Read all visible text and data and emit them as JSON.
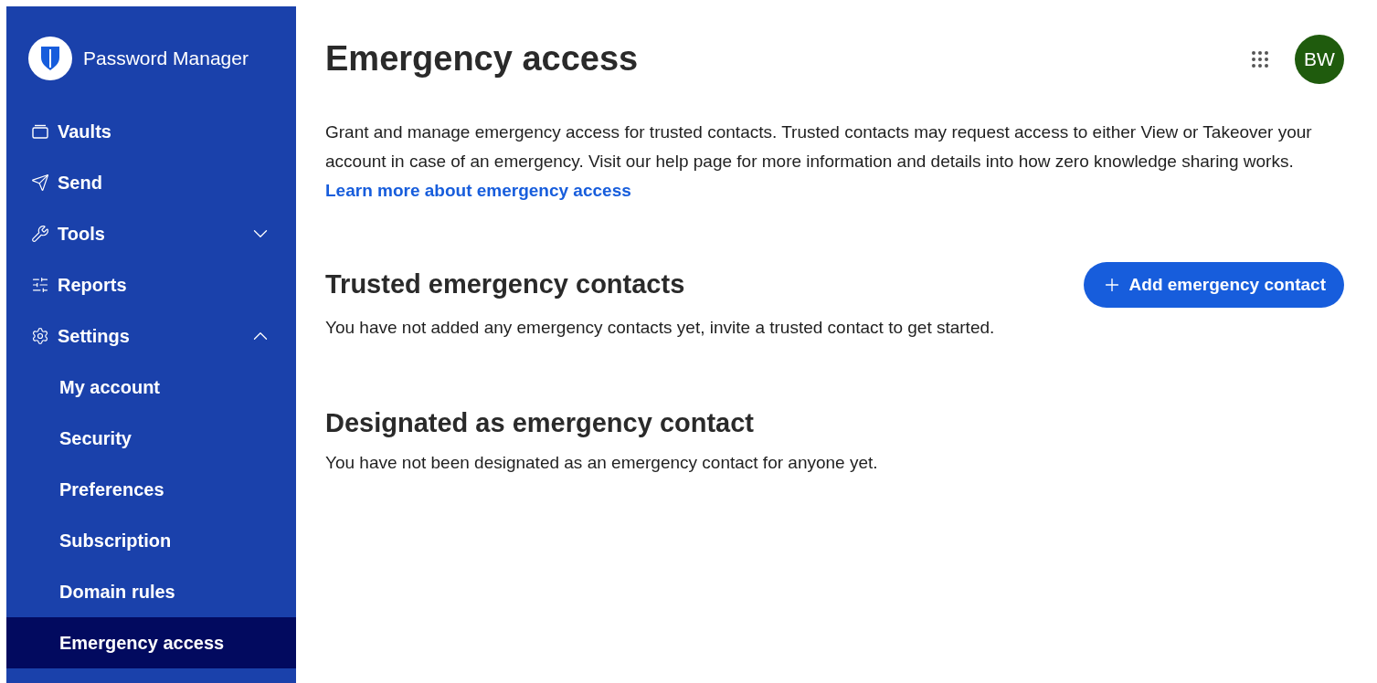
{
  "sidebar": {
    "product": "Password Manager",
    "items": [
      {
        "label": "Vaults"
      },
      {
        "label": "Send"
      },
      {
        "label": "Tools",
        "expanded": false
      },
      {
        "label": "Reports"
      },
      {
        "label": "Settings",
        "expanded": true,
        "children": [
          {
            "label": "My account",
            "selected": false
          },
          {
            "label": "Security",
            "selected": false
          },
          {
            "label": "Preferences",
            "selected": false
          },
          {
            "label": "Subscription",
            "selected": false
          },
          {
            "label": "Domain rules",
            "selected": false
          },
          {
            "label": "Emergency access",
            "selected": true
          }
        ]
      }
    ]
  },
  "header": {
    "title": "Emergency access",
    "avatar": "BW"
  },
  "description": {
    "text": "Grant and manage emergency access for trusted contacts. Trusted contacts may request access to either View or Takeover your account in case of an emergency. Visit our help page for more information and details into how zero knowledge sharing works.",
    "link": "Learn more about emergency access"
  },
  "sections": [
    {
      "title": "Trusted emergency contacts",
      "button": "Add emergency contact",
      "empty_text": "You have not added any emergency contacts yet, invite a trusted contact to get started."
    },
    {
      "title": "Designated as emergency contact",
      "empty_text": "You have not been designated as an emergency contact for anyone yet."
    }
  ]
}
